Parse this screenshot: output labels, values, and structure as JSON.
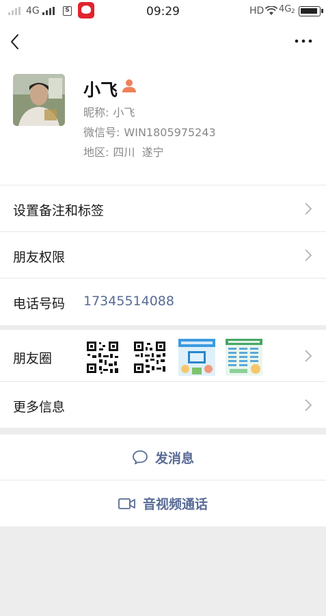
{
  "status_bar": {
    "network_left": "4G",
    "time": "09:29",
    "network_right_hd": "HD",
    "network_right": "4G",
    "sim_slot": "2"
  },
  "profile": {
    "name": "小飞",
    "nickname_label": "昵称:",
    "nickname": "小飞",
    "wechat_id_label": "微信号:",
    "wechat_id": "WIN1805975243",
    "region_label": "地区:",
    "region": "四川  遂宁"
  },
  "menu": {
    "remark_tags": "设置备注和标签",
    "friend_permissions": "朋友权限",
    "phone_label": "电话号码",
    "phone_value": "17345514088",
    "moments": "朋友圈",
    "more_info": "更多信息"
  },
  "actions": {
    "send_message": "发消息",
    "av_call": "音视频通话"
  },
  "colors": {
    "link": "#576b95",
    "badge": "#f0805a",
    "background": "#ededed"
  }
}
